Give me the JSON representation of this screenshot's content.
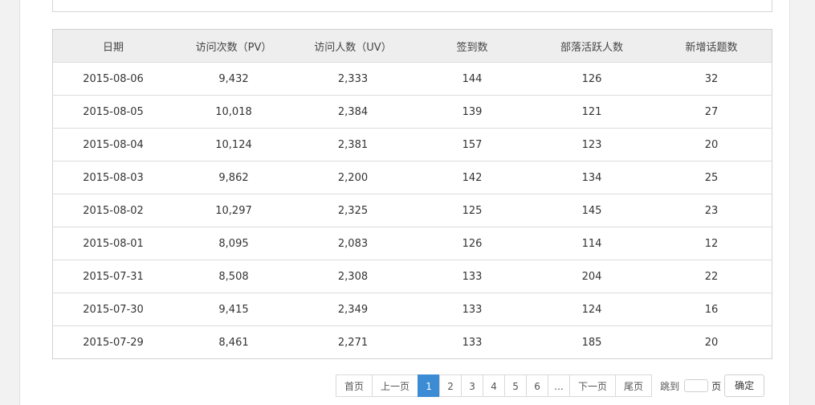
{
  "table": {
    "headers": [
      "日期",
      "访问次数（PV）",
      "访问人数（UV）",
      "签到数",
      "部落活跃人数",
      "新增话题数"
    ],
    "rows": [
      [
        "2015-08-06",
        "9,432",
        "2,333",
        "144",
        "126",
        "32"
      ],
      [
        "2015-08-05",
        "10,018",
        "2,384",
        "139",
        "121",
        "27"
      ],
      [
        "2015-08-04",
        "10,124",
        "2,381",
        "157",
        "123",
        "20"
      ],
      [
        "2015-08-03",
        "9,862",
        "2,200",
        "142",
        "134",
        "25"
      ],
      [
        "2015-08-02",
        "10,297",
        "2,325",
        "125",
        "145",
        "23"
      ],
      [
        "2015-08-01",
        "8,095",
        "2,083",
        "126",
        "114",
        "12"
      ],
      [
        "2015-07-31",
        "8,508",
        "2,308",
        "133",
        "204",
        "22"
      ],
      [
        "2015-07-30",
        "9,415",
        "2,349",
        "133",
        "124",
        "16"
      ],
      [
        "2015-07-29",
        "8,461",
        "2,271",
        "133",
        "185",
        "20"
      ]
    ]
  },
  "pagination": {
    "first": "首页",
    "prev": "上一页",
    "pages": [
      "1",
      "2",
      "3",
      "4",
      "5",
      "6"
    ],
    "current": "1",
    "ellipsis": "...",
    "next": "下一页",
    "last": "尾页",
    "jump_label": "跳到",
    "jump_value": "",
    "page_unit": "页",
    "confirm": "确定",
    "active_color": "#3b8bd5"
  }
}
